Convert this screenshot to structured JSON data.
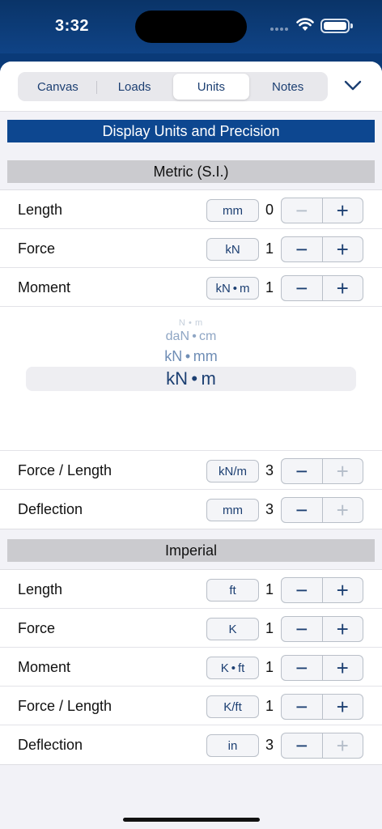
{
  "status_bar": {
    "time": "3:32"
  },
  "tabs": [
    {
      "label": "Canvas",
      "active": false
    },
    {
      "label": "Loads",
      "active": false
    },
    {
      "label": "Units",
      "active": true
    },
    {
      "label": "Notes",
      "active": false
    }
  ],
  "title": "Display Units and Precision",
  "metric": {
    "header": "Metric (S.I.)",
    "rows_top": [
      {
        "label": "Length",
        "unit": "mm",
        "precision": "0",
        "minus_enabled": false,
        "plus_enabled": true
      },
      {
        "label": "Force",
        "unit": "kN",
        "precision": "1",
        "minus_enabled": true,
        "plus_enabled": true
      },
      {
        "label": "Moment",
        "unit": "kN • m",
        "precision": "1",
        "minus_enabled": true,
        "plus_enabled": true
      }
    ],
    "picker": {
      "options": [
        "N • m",
        "daN • cm",
        "kN • mm"
      ],
      "selected": "kN • m"
    },
    "rows_bottom": [
      {
        "label": "Force / Length",
        "unit": "kN/m",
        "precision": "3",
        "minus_enabled": true,
        "plus_enabled": false
      },
      {
        "label": "Deflection",
        "unit": "mm",
        "precision": "3",
        "minus_enabled": true,
        "plus_enabled": false
      }
    ]
  },
  "imperial": {
    "header": "Imperial",
    "rows": [
      {
        "label": "Length",
        "unit": "ft",
        "precision": "1",
        "minus_enabled": true,
        "plus_enabled": true
      },
      {
        "label": "Force",
        "unit": "K",
        "precision": "1",
        "minus_enabled": true,
        "plus_enabled": true
      },
      {
        "label": "Moment",
        "unit": "K • ft",
        "precision": "1",
        "minus_enabled": true,
        "plus_enabled": true
      },
      {
        "label": "Force / Length",
        "unit": "K/ft",
        "precision": "1",
        "minus_enabled": true,
        "plus_enabled": true
      },
      {
        "label": "Deflection",
        "unit": "in",
        "precision": "3",
        "minus_enabled": true,
        "plus_enabled": false
      }
    ]
  },
  "stepper": {
    "minus": "−",
    "plus": "+"
  },
  "icons": [
    "wifi-icon",
    "battery-icon",
    "chevron-down-icon",
    "minus-icon",
    "plus-icon"
  ]
}
